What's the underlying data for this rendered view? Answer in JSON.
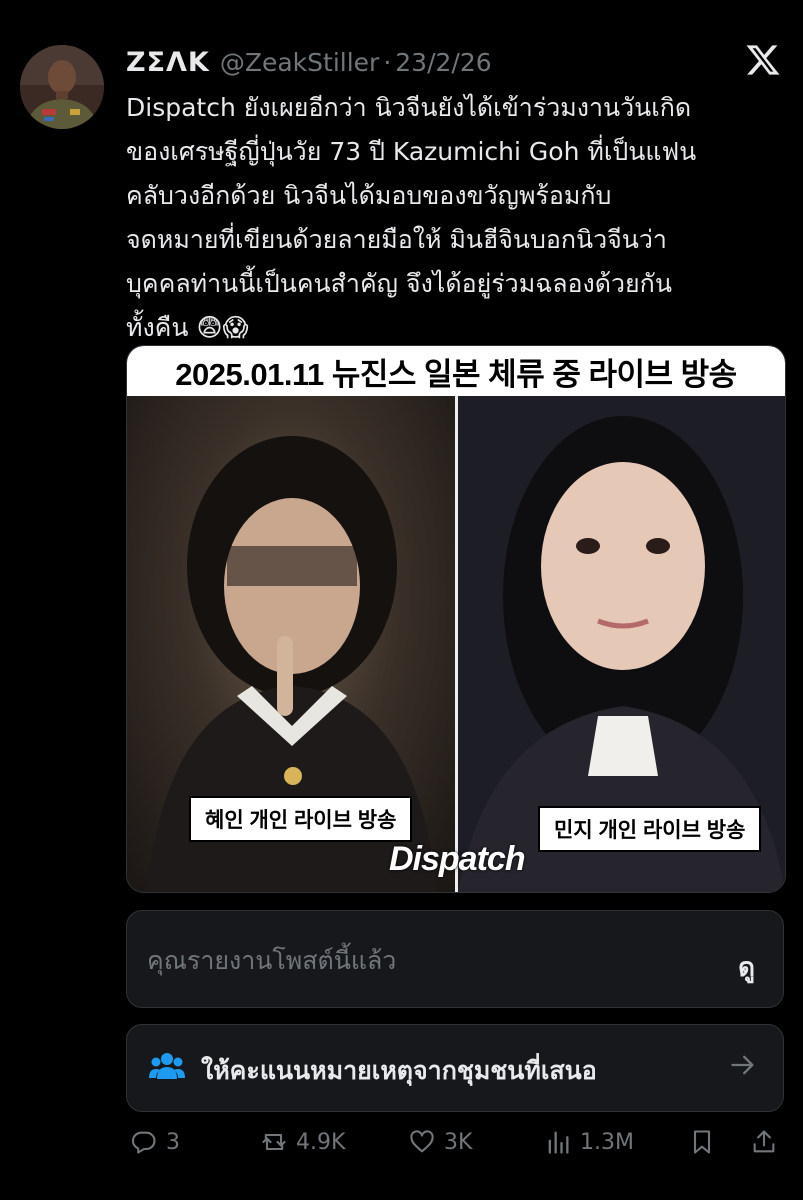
{
  "author": {
    "display_name": "ZΣΛK",
    "handle": "@ZeakStiller",
    "separator": "·",
    "date": "23/2/26"
  },
  "tweet": {
    "lines": [
      "Dispatch ยังเผยอีกว่า นิวจีนยังได้เข้าร่วมงานวันเกิด",
      "ของเศรษฐีญี่ปุ่นวัย 73 ปี Kazumichi Goh ที่เป็นแฟน",
      "คลับวงอีกด้วย  นิวจีนได้มอบของขวัญพร้อมกับ",
      "จดหมายที่เขียนด้วยลายมือให้ มินฮีจินบอกนิวจีนว่า",
      "บุคคลท่านนี้เป็นคนสำคัญ จึงได้อยู่ร่วมฉลองด้วยกัน",
      "ทั้งคืน 😨😱"
    ]
  },
  "media": {
    "header": "2025.01.11 뉴진스 일본 체류 중 라이브 방송",
    "caption_left": "혜인 개인 라이브 방송",
    "caption_right": "민지 개인 라이브 방송",
    "watermark": "Dispatch"
  },
  "report": {
    "text": "คุณรายงานโพสต์นี้แล้ว",
    "view_label": "ดู"
  },
  "community_note": {
    "text": "ให้คะแนนหมายเหตุจากชุมชนที่เสนอ",
    "icon": "people-icon"
  },
  "actions": {
    "replies": "3",
    "reposts": "4.9K",
    "likes": "3K",
    "views": "1.3M"
  }
}
